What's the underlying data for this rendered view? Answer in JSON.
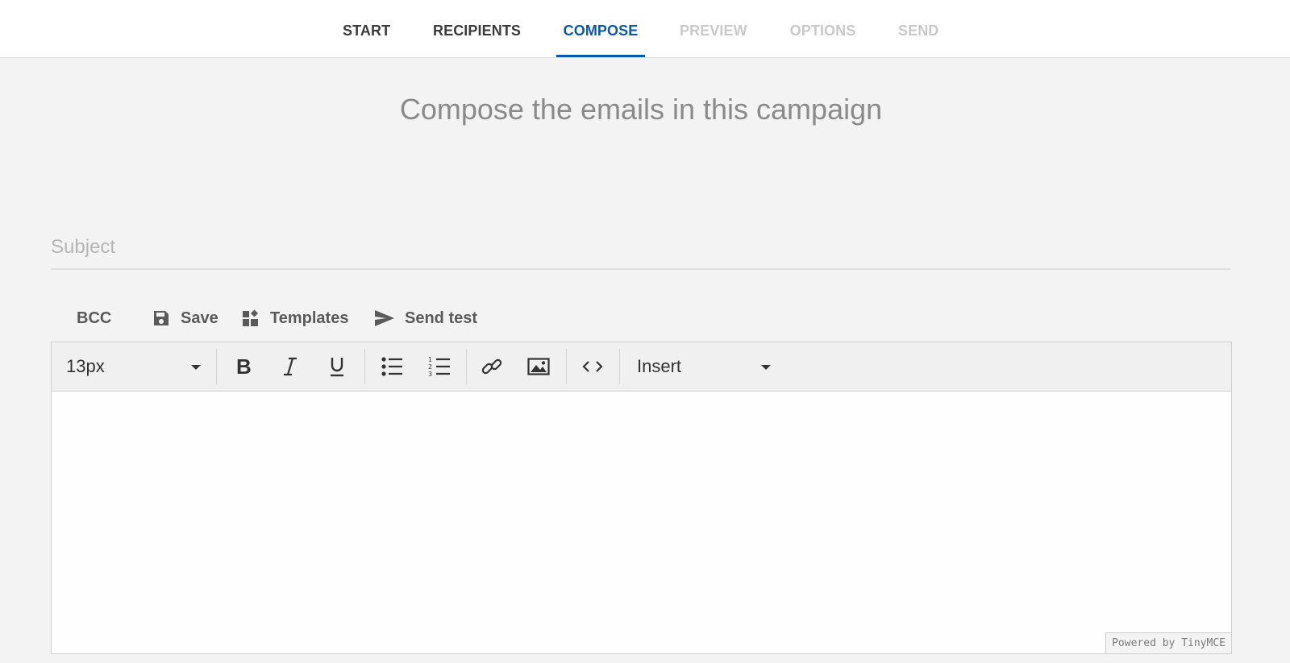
{
  "nav": {
    "tabs": [
      {
        "label": "START",
        "state": "done"
      },
      {
        "label": "RECIPIENTS",
        "state": "done"
      },
      {
        "label": "COMPOSE",
        "state": "active"
      },
      {
        "label": "PREVIEW",
        "state": "disabled"
      },
      {
        "label": "OPTIONS",
        "state": "disabled"
      },
      {
        "label": "SEND",
        "state": "disabled"
      }
    ]
  },
  "page": {
    "heading": "Compose the emails in this campaign"
  },
  "subject": {
    "placeholder": "Subject",
    "value": ""
  },
  "actions": {
    "bcc": "BCC",
    "save": "Save",
    "templates": "Templates",
    "send_test": "Send test"
  },
  "editor": {
    "font_size": "13px",
    "insert_label": "Insert",
    "powered_by": "Powered by TinyMCE",
    "tools": [
      "bold-icon",
      "italic-icon",
      "underline-icon",
      "bullet-list-icon",
      "numbered-list-icon",
      "link-icon",
      "image-icon",
      "source-code-icon"
    ]
  },
  "colors": {
    "accent": "#0b58a6",
    "background": "#f3f3f3",
    "disabled_tab": "#c9c9c9"
  }
}
